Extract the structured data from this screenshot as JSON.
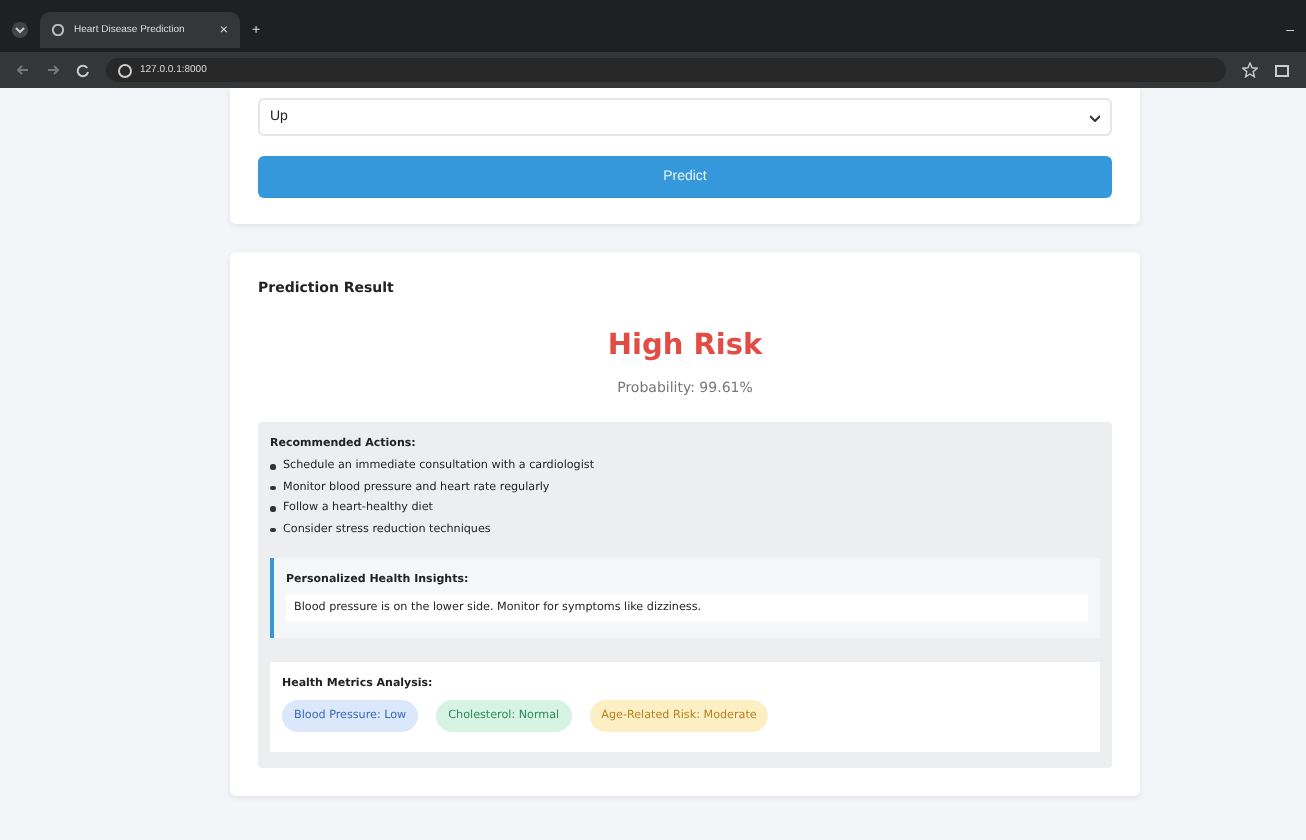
{
  "browser": {
    "tab_title": "Heart Disease Prediction",
    "tab_close": "×",
    "new_tab": "+",
    "url": "127.0.0.1:8000",
    "minimize": "–"
  },
  "form": {
    "select_value": "Up",
    "predict_button": "Predict"
  },
  "result": {
    "title": "Prediction Result",
    "risk": "High Risk",
    "probability": "Probability: 99.61%",
    "actions_title": "Recommended Actions:",
    "actions": [
      "Schedule an immediate consultation with a cardiologist",
      "Monitor blood pressure and heart rate regularly",
      "Follow a heart-healthy diet",
      "Consider stress reduction techniques"
    ],
    "insights_title": "Personalized Health Insights:",
    "insights": [
      "Blood pressure is on the lower side. Monitor for symptoms like dizziness."
    ],
    "metrics_title": "Health Metrics Analysis:",
    "metrics": [
      {
        "label": "Blood Pressure: Low",
        "color": "#dbe8fb"
      },
      {
        "label": "Cholesterol: Normal",
        "color": "#d6f3e3"
      },
      {
        "label": "Age-Related Risk: Moderate",
        "color": "#fdefc4"
      }
    ]
  }
}
